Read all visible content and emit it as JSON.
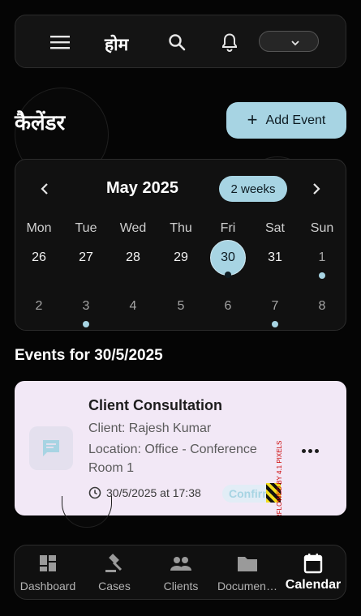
{
  "header": {
    "title": "होम"
  },
  "page": {
    "title": "कैलेंडर",
    "add_event_label": "Add Event"
  },
  "calendar": {
    "month_label": "May 2025",
    "view_toggle": "2 weeks",
    "weekdays": [
      "Mon",
      "Tue",
      "Wed",
      "Thu",
      "Fri",
      "Sat",
      "Sun"
    ],
    "week1": [
      "26",
      "27",
      "28",
      "29",
      "30",
      "31",
      "1"
    ],
    "week2": [
      "2",
      "3",
      "4",
      "5",
      "6",
      "7",
      "8"
    ],
    "selected_day": "30",
    "accent_color": "#a7d4e3"
  },
  "events": {
    "heading": "Events for 30/5/2025",
    "items": [
      {
        "title": "Client Consultation",
        "client": "Client: Rajesh Kumar",
        "location": "Location: Office - Conference Room 1",
        "datetime": "30/5/2025 at 17:38",
        "status": "Confirmed",
        "icon": "chat-bubble-icon"
      }
    ],
    "overflow_warning": "RFLOWED BY 4.1 PIXELS"
  },
  "bottom_nav": {
    "items": [
      {
        "label": "Dashboard",
        "icon": "dashboard-icon"
      },
      {
        "label": "Cases",
        "icon": "gavel-icon"
      },
      {
        "label": "Clients",
        "icon": "people-icon"
      },
      {
        "label": "Documen…",
        "icon": "folder-icon"
      },
      {
        "label": "Calendar",
        "icon": "calendar-icon"
      }
    ],
    "active": "Calendar"
  }
}
